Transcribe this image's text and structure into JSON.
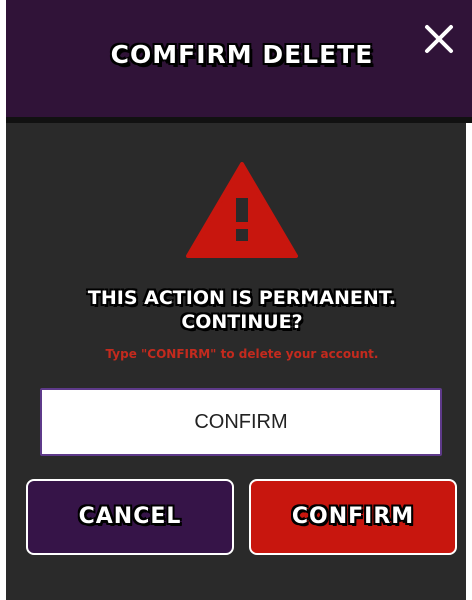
{
  "dialog": {
    "title": "COMFIRM DELETE",
    "close_icon": "close-icon",
    "warning_icon": "warning-triangle-icon",
    "message_line1": "THIS ACTION IS PERMANENT.",
    "message_line2": "CONTINUE?",
    "instruction": "Type \"CONFIRM\" to delete your account.",
    "input_value": "CONFIRM",
    "cancel_label": "CANCEL",
    "confirm_label": "CONFIRM"
  },
  "colors": {
    "header_bg": "#301338",
    "body_bg": "#2a2a2a",
    "warning_red": "#c8160e",
    "instruction_red": "#c42a1e",
    "cancel_bg": "#361448",
    "input_border": "#5e3a8a"
  }
}
